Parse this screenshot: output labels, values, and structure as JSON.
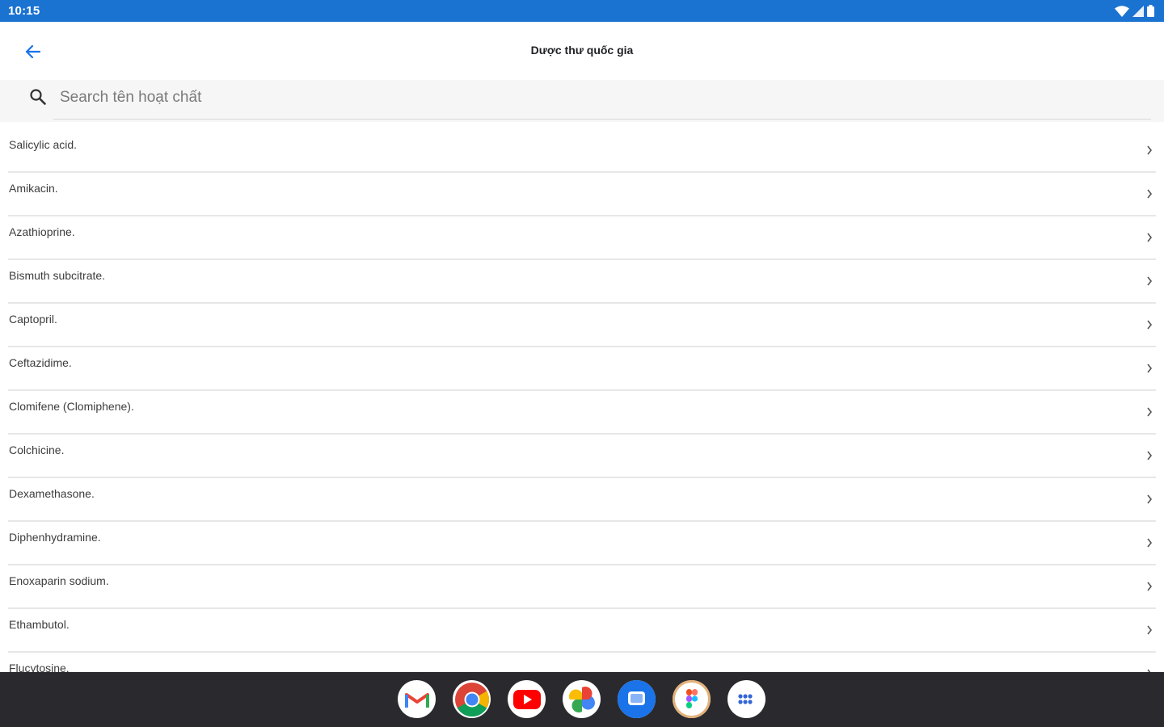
{
  "status_bar": {
    "time": "10:15",
    "icons": [
      "wifi-icon",
      "cellular-icon",
      "battery-icon"
    ]
  },
  "app_bar": {
    "title": "Dược thư quốc gia",
    "back_icon": "arrow-back-icon"
  },
  "search": {
    "placeholder": "Search tên hoạt chất",
    "value": "",
    "icon": "search-icon"
  },
  "drug_list": [
    "Salicylic acid.",
    "Amikacin.",
    "Azathioprine.",
    "Bismuth subcitrate.",
    "Captopril.",
    "Ceftazidime.",
    "Clomifene (Clomiphene).",
    "Colchicine.",
    "Dexamethasone.",
    "Diphenhydramine.",
    "Enoxaparin sodium.",
    "Ethambutol.",
    "Flucytosine."
  ],
  "dock": {
    "apps": [
      "gmail-icon",
      "chrome-icon",
      "youtube-icon",
      "photos-icon",
      "messages-icon",
      "figma-icon",
      "app-drawer-icon"
    ]
  },
  "colors": {
    "status_bar": "#1a73d1",
    "accent": "#1a73e8",
    "dock": "#2a2a2e"
  }
}
